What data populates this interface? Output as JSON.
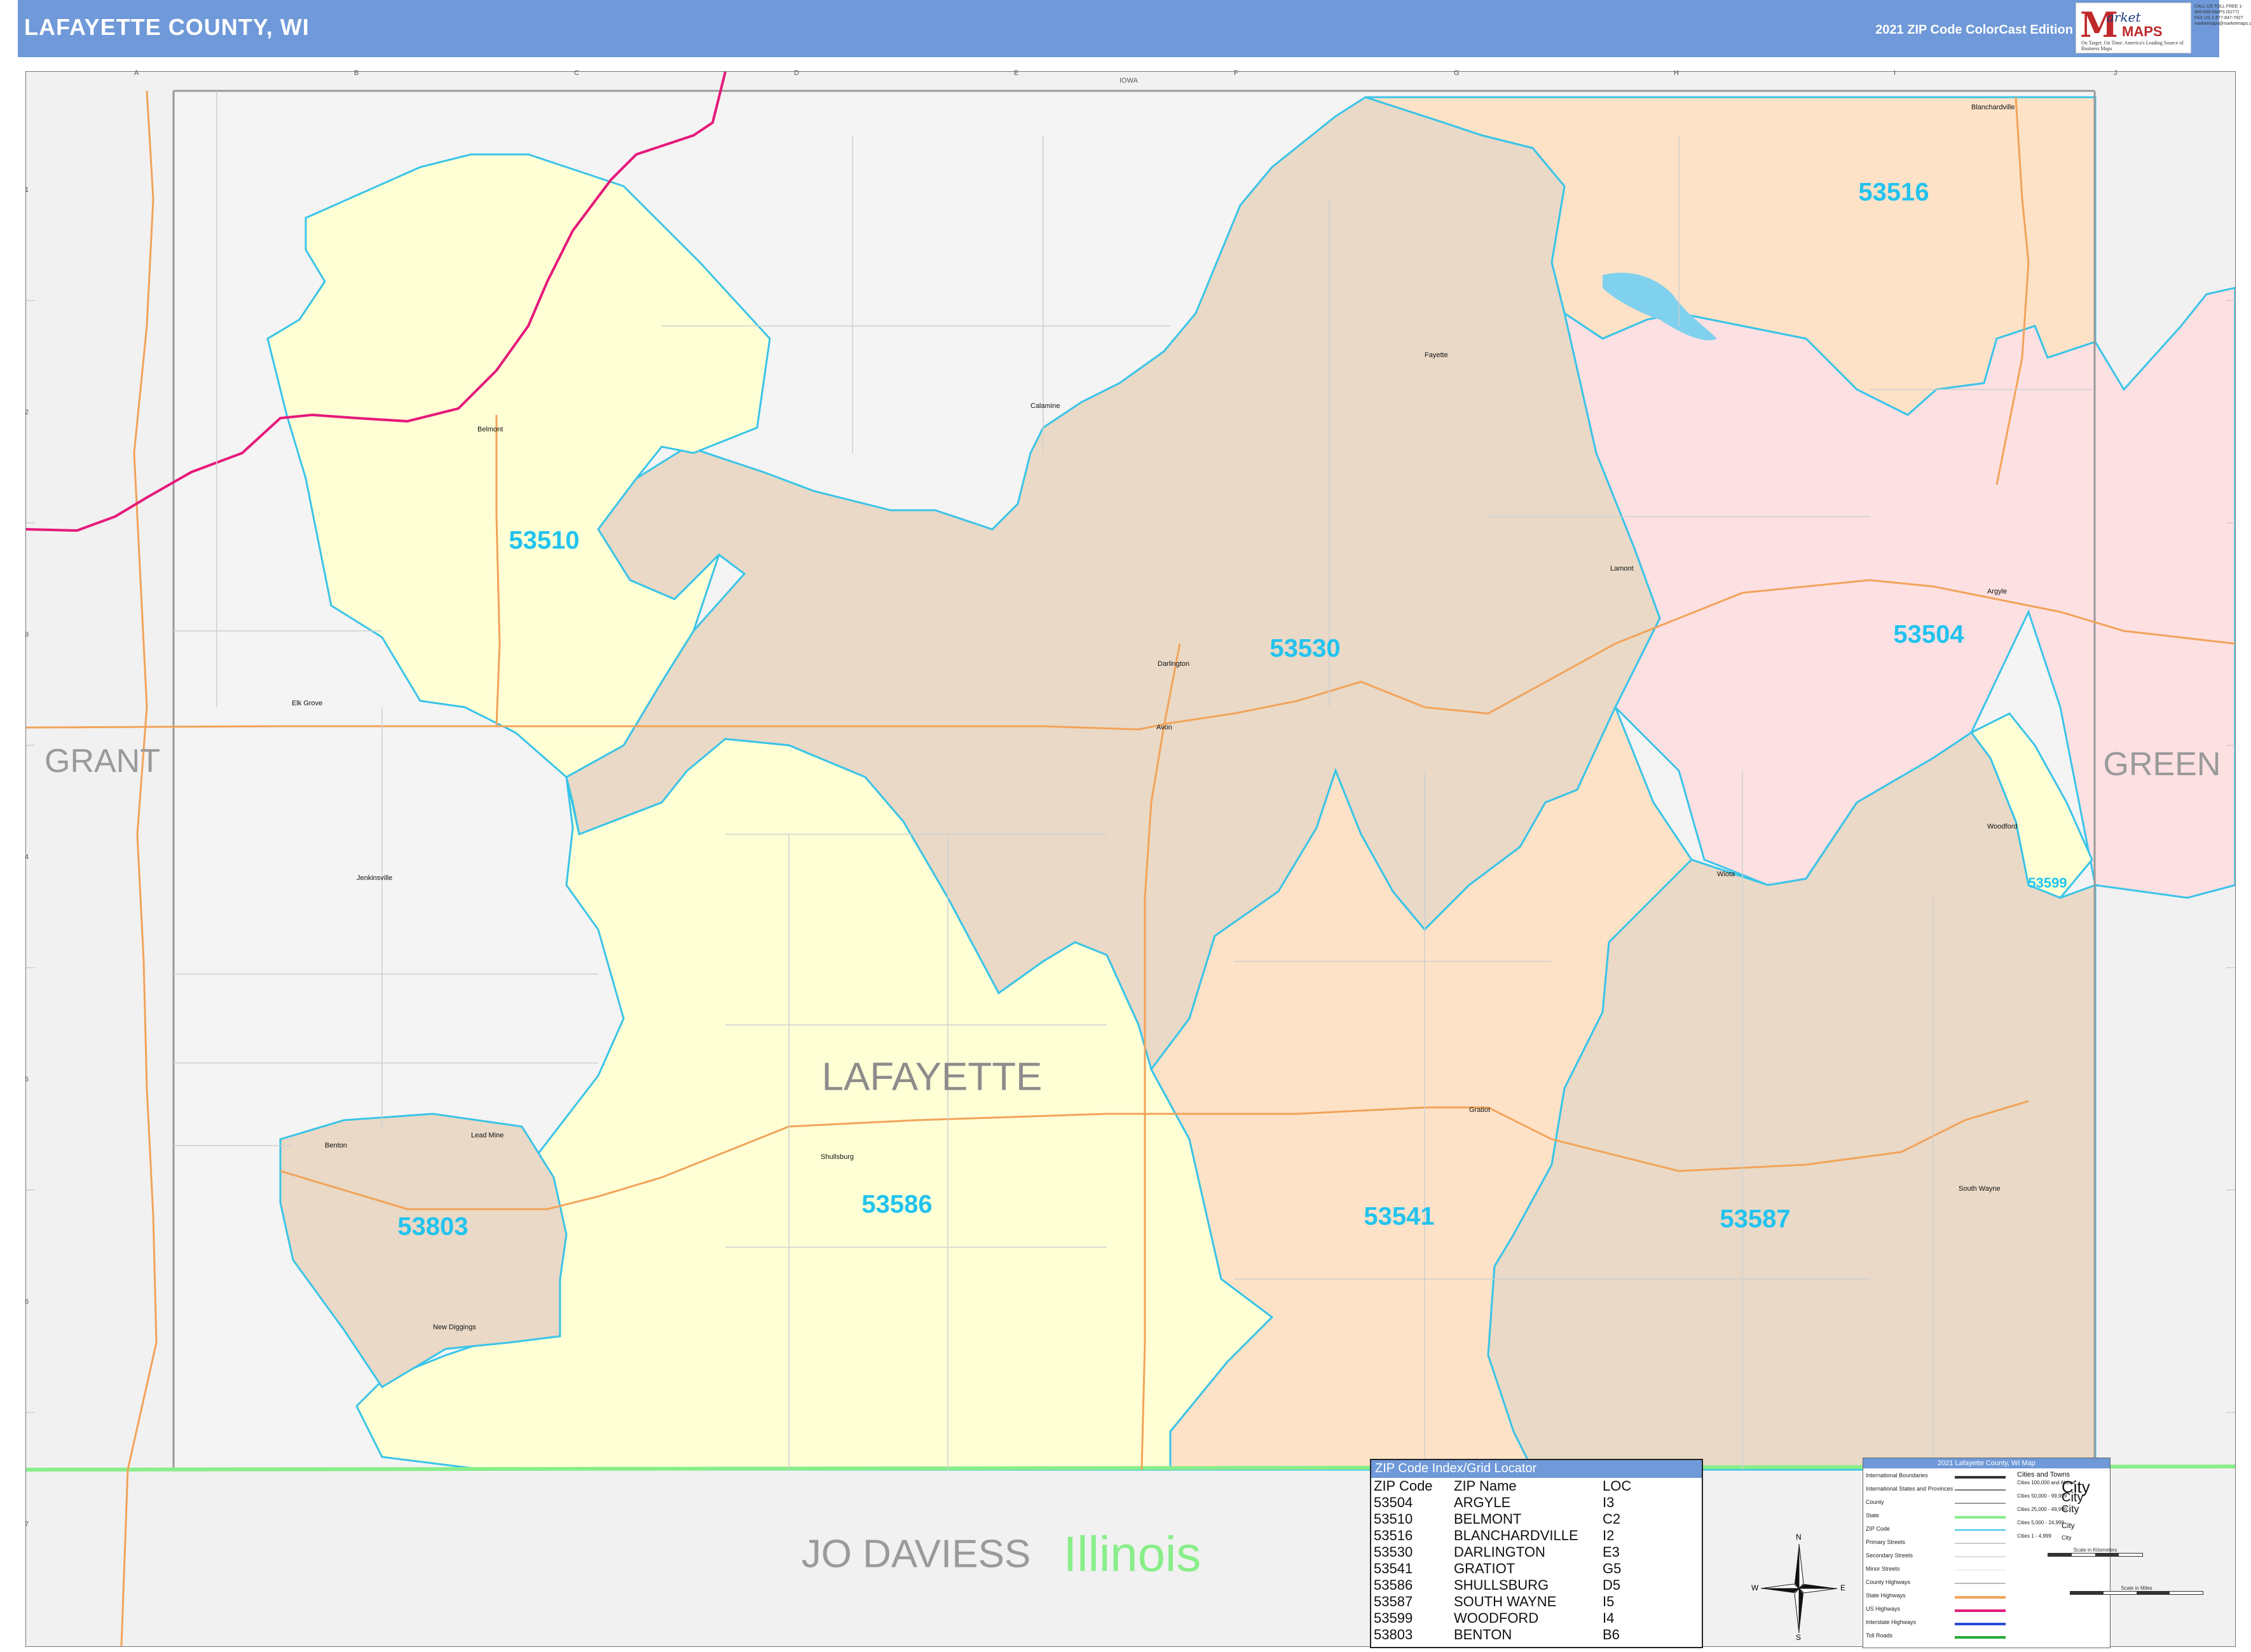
{
  "header": {
    "title": "LAFAYETTE COUNTY, WI",
    "edition": "2021 ZIP Code ColorCast Edition",
    "logo_m": "M",
    "logo_arket": "arket",
    "logo_maps": "MAPS",
    "logo_tagline": "On Target. On Time. America's Leading Source of Business Maps",
    "contact": "CALL US TOLL FREE 1-800-839-MAPS (6277) FAX US 1-877-847-7927 marketmaps@marketmaps.com"
  },
  "grid": {
    "columns": [
      "A",
      "B",
      "C",
      "D",
      "E",
      "F",
      "G",
      "H",
      "I",
      "J"
    ],
    "rows": [
      "1",
      "2",
      "3",
      "4",
      "5",
      "6",
      "7"
    ]
  },
  "map": {
    "state_top_label": "IOWA",
    "counties": {
      "left": "GRANT",
      "right": "GREEN",
      "center": "LAFAYETTE",
      "bottom": "JO DAVIESS"
    },
    "state_bottom": "Illinois",
    "zip_labels": {
      "53510": "53510",
      "53516": "53516",
      "53530": "53530",
      "53504": "53504",
      "53599": "53599",
      "53586": "53586",
      "53803": "53803",
      "53541": "53541",
      "53587": "53587"
    },
    "cities": {
      "belmont": "Belmont",
      "calamine": "Calamine",
      "fayette": "Fayette",
      "blanchardville": "Blanchardville",
      "lamont": "Lamont",
      "argyle": "Argyle",
      "darlington": "Darlington",
      "avon": "Avon",
      "elk_grove": "Elk Grove",
      "jenkinsville": "Jenkinsville",
      "woodford": "Woodford",
      "wiota": "Wiota",
      "shullsburg": "Shullsburg",
      "benton": "Benton",
      "lead_mine": "Lead Mine",
      "new_diggings": "New Diggings",
      "gratiot": "Gratiot",
      "south_wayne": "South Wayne"
    },
    "colors": {
      "yellow_zip": "#ffffd6",
      "tan_zip": "#e9d9c6",
      "peach_zip": "#fde2c8",
      "pink_zip": "#fde0e2",
      "outside": "#f1f1f1",
      "zip_line": "#3ac4e8",
      "interstate": "#e6197a",
      "state_highway": "#f2a35a",
      "state_border": "#88ee88",
      "zip_text": "#22c3ee"
    }
  },
  "zip_index": {
    "title": "ZIP Code Index/Grid Locator",
    "headers": {
      "zip": "ZIP Code",
      "name": "ZIP Name",
      "loc": "LOC"
    },
    "rows": [
      {
        "zip": "53504",
        "name": "ARGYLE",
        "loc": "I3"
      },
      {
        "zip": "53510",
        "name": "BELMONT",
        "loc": "C2"
      },
      {
        "zip": "53516",
        "name": "BLANCHARDVILLE",
        "loc": "I2"
      },
      {
        "zip": "53530",
        "name": "DARLINGTON",
        "loc": "E3"
      },
      {
        "zip": "53541",
        "name": "GRATIOT",
        "loc": "G5"
      },
      {
        "zip": "53586",
        "name": "SHULLSBURG",
        "loc": "D5"
      },
      {
        "zip": "53587",
        "name": "SOUTH WAYNE",
        "loc": "I5"
      },
      {
        "zip": "53599",
        "name": "WOODFORD",
        "loc": "I4"
      },
      {
        "zip": "53803",
        "name": "BENTON",
        "loc": "B6"
      }
    ]
  },
  "legend": {
    "title": "2021 Lafayette County, WI Map",
    "items": [
      {
        "label": "International Boundaries",
        "color": "#333333"
      },
      {
        "label": "International States and Provinces",
        "color": "#777777"
      },
      {
        "label": "County",
        "color": "#999999"
      },
      {
        "label": "State",
        "color": "#88ee88"
      },
      {
        "label": "ZIP Code",
        "color": "#3ac4e8"
      },
      {
        "label": "Primary Streets",
        "color": "#cccccc"
      },
      {
        "label": "Secondary Streets",
        "color": "#dddddd"
      },
      {
        "label": "Minor Streets",
        "color": "#eeeeee"
      },
      {
        "label": "County Highways",
        "color": "#bbbbbb"
      },
      {
        "label": "State Highways",
        "color": "#f2a35a"
      },
      {
        "label": "US Highways",
        "color": "#e6197a"
      },
      {
        "label": "Interstate Highways",
        "color": "#2a4ad8"
      },
      {
        "label": "Toll Roads",
        "color": "#22aa33"
      }
    ],
    "cities_head": "Cities and Towns",
    "city_sizes": [
      {
        "label": "Cities 100,000 and Above",
        "sample": "City"
      },
      {
        "label": "Cities 50,000 - 99,999",
        "sample": "City"
      },
      {
        "label": "Cities 25,000 - 49,999",
        "sample": "City"
      },
      {
        "label": "Cities 5,000 - 24,999",
        "sample": "City"
      },
      {
        "label": "Cities 1 - 4,999",
        "sample": "City"
      }
    ],
    "scale_km": "Scale in Kilometers",
    "scale_mi": "Scale in Miles"
  },
  "compass": {
    "n": "N",
    "s": "S",
    "e": "E",
    "w": "W"
  }
}
